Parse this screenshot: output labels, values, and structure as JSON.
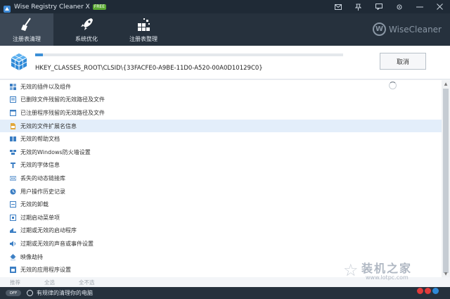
{
  "window": {
    "title": "Wise Registry Cleaner X",
    "badge": "FREE",
    "controls": [
      "mail-icon",
      "pin-icon",
      "feedback-icon",
      "settings-icon",
      "minimize-icon",
      "close-icon"
    ]
  },
  "nav": {
    "tabs": [
      {
        "label": "注册表清理",
        "icon": "broom-icon",
        "active": true
      },
      {
        "label": "系统优化",
        "icon": "rocket-icon",
        "active": false
      },
      {
        "label": "注册表整理",
        "icon": "blocks-icon",
        "active": false
      }
    ],
    "brand": "WiseCleaner",
    "brand_mark": "W"
  },
  "scan": {
    "path": "HKEY_CLASSES_ROOT\\CLSID\\{33FACFE0-A9BE-11D0-A520-00A0D10129C0}",
    "progress_percent": 2.5,
    "cancel_label": "取消"
  },
  "items": [
    {
      "label": "无效的插件以及组件",
      "icon": "plugin-icon"
    },
    {
      "label": "已删除文件残留的无效路径及文件",
      "icon": "file-list-icon"
    },
    {
      "label": "已注册程序残留的无效路径及文件",
      "icon": "program-icon"
    },
    {
      "label": "无效的文件扩展名信息",
      "icon": "file-extension-icon",
      "highlight": true
    },
    {
      "label": "无效的帮助文档",
      "icon": "help-doc-icon"
    },
    {
      "label": "无效的Windows防火墙设置",
      "icon": "firewall-icon"
    },
    {
      "label": "无效的字体信息",
      "icon": "font-icon"
    },
    {
      "label": "丢失的动态链接库",
      "icon": "dll-icon"
    },
    {
      "label": "用户操作历史记录",
      "icon": "history-icon"
    },
    {
      "label": "无效的卸载",
      "icon": "uninstall-icon"
    },
    {
      "label": "过期启动菜单项",
      "icon": "start-menu-icon"
    },
    {
      "label": "过期或无效的启动程序",
      "icon": "startup-icon"
    },
    {
      "label": "过期或无效的声音或事件设置",
      "icon": "sound-icon"
    },
    {
      "label": "映像劫持",
      "icon": "hijack-icon"
    },
    {
      "label": "无效的应用程序设置",
      "icon": "app-settings-icon"
    }
  ],
  "selection": {
    "recommended": "推荐",
    "select_all": "全选",
    "select_none": "全不选"
  },
  "status": {
    "toggle_label": "OFF",
    "schedule_text": "有规律的清理你的电脑"
  },
  "watermark": {
    "text": "装机之家",
    "url": "www.lotpc.com"
  }
}
